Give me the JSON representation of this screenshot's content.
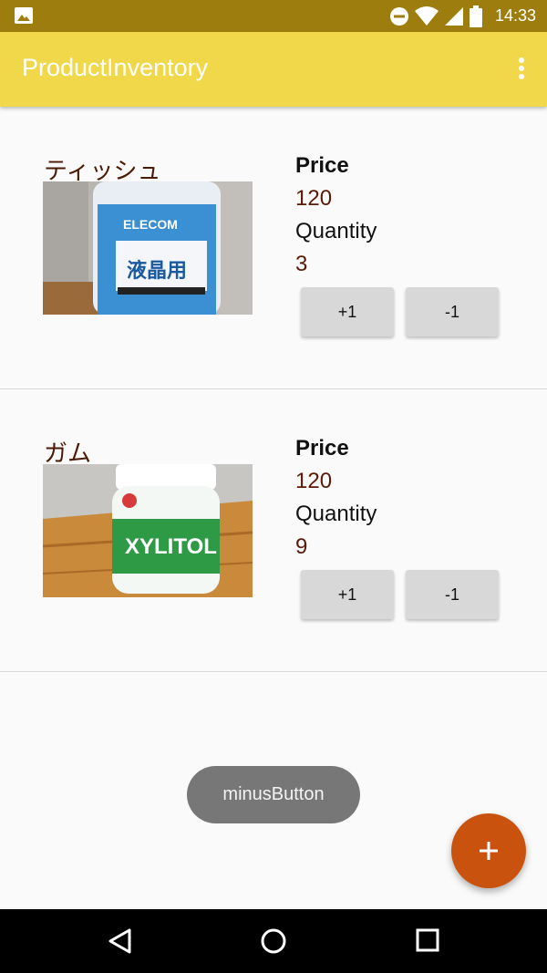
{
  "status_bar": {
    "time": "14:33",
    "icons": [
      "image-icon",
      "do-not-disturb-icon",
      "wifi-icon",
      "signal-icon",
      "battery-icon"
    ]
  },
  "app_bar": {
    "title": "ProductInventory",
    "menu_icon": "overflow-menu-icon",
    "background": "#f0d84a"
  },
  "products": [
    {
      "name": "ティッシュ",
      "price_label": "Price",
      "price": "120",
      "quantity_label": "Quantity",
      "quantity": "3",
      "plus_label": "+1",
      "minus_label": "-1",
      "image_icon": "product-photo-elecom-bottle"
    },
    {
      "name": "ガム",
      "price_label": "Price",
      "price": "120",
      "quantity_label": "Quantity",
      "quantity": "9",
      "plus_label": "+1",
      "minus_label": "-1",
      "image_icon": "product-photo-xylitol-gum"
    }
  ],
  "toast": {
    "text": "minusButton"
  },
  "fab": {
    "icon": "add-icon",
    "color": "#c9520e"
  },
  "nav_bar": {
    "icons": [
      "back-icon",
      "home-icon",
      "recents-icon"
    ]
  }
}
